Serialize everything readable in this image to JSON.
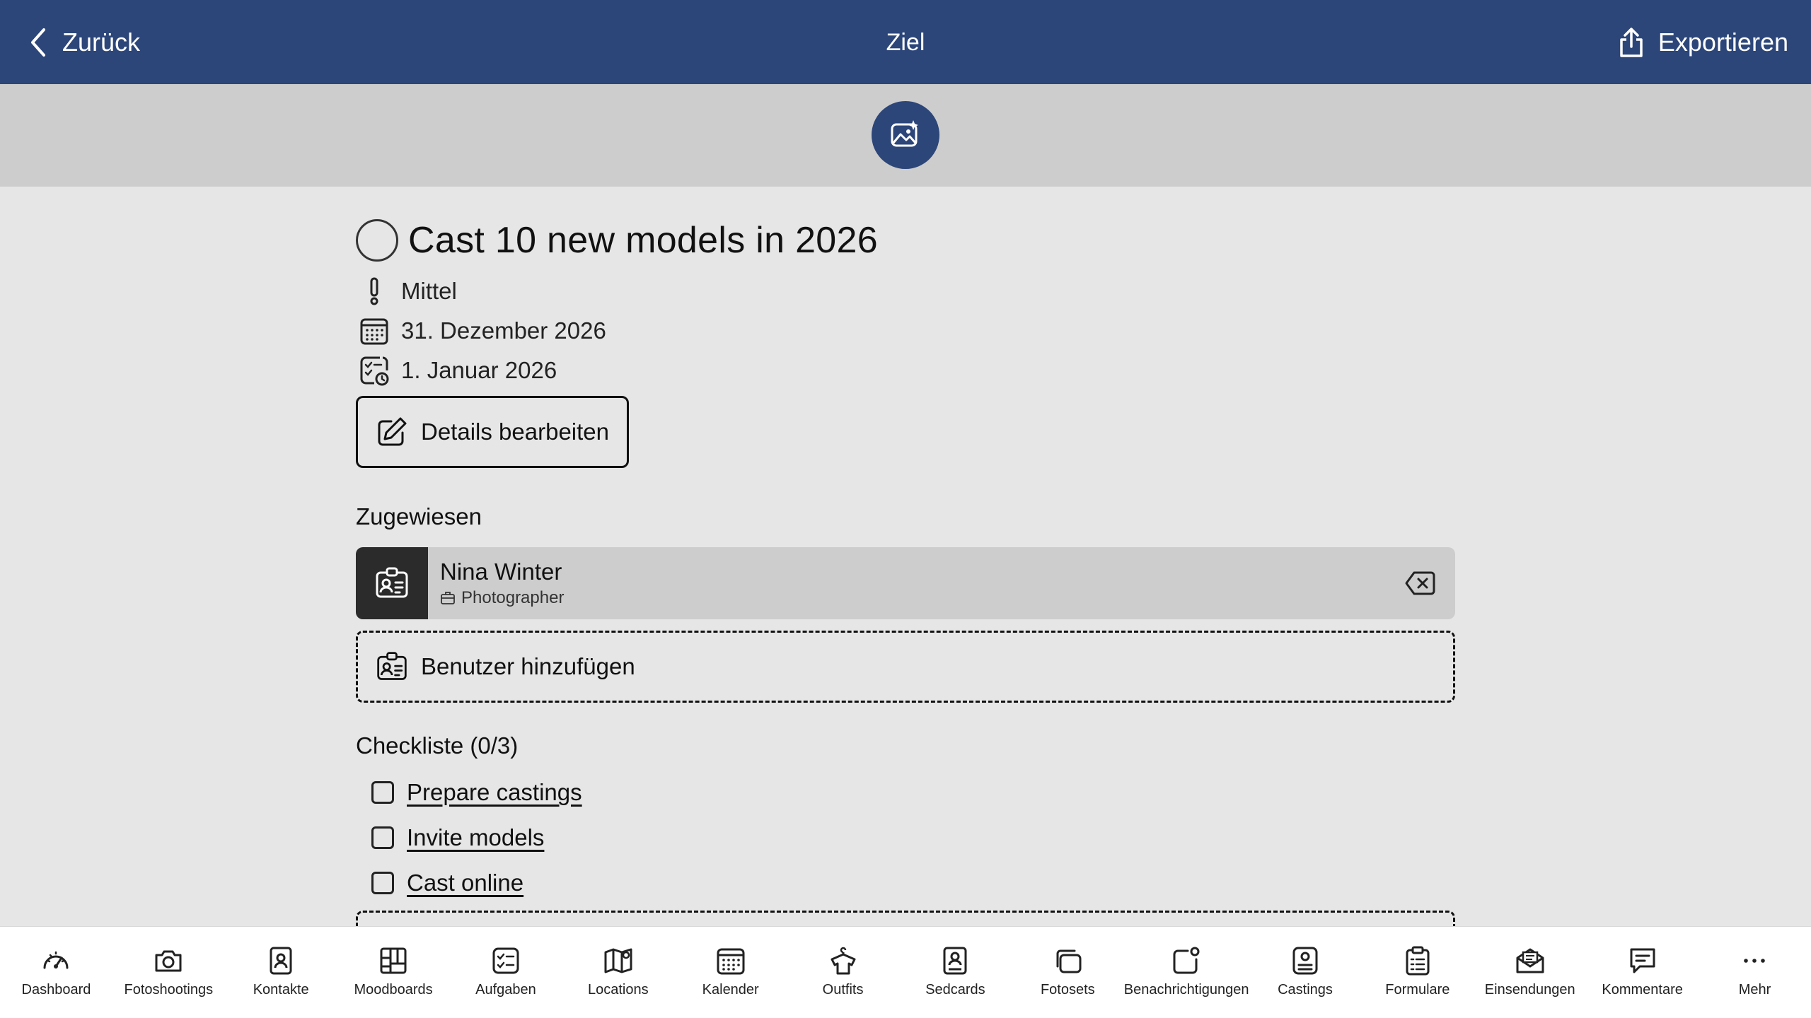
{
  "header": {
    "back_label": "Zurück",
    "title": "Ziel",
    "export_label": "Exportieren",
    "color": "#2c4679"
  },
  "goal": {
    "title": "Cast 10 new models in 2026",
    "priority": "Mittel",
    "due_date": "31. Dezember 2026",
    "start_date": "1. Januar 2026",
    "edit_label": "Details bearbeiten"
  },
  "assigned": {
    "label": "Zugewiesen",
    "users": [
      {
        "name": "Nina Winter",
        "role": "Photographer"
      }
    ],
    "add_label": "Benutzer hinzufügen"
  },
  "checklist": {
    "label": "Checkliste (0/3)",
    "items": [
      {
        "label": "Prepare castings",
        "checked": false
      },
      {
        "label": "Invite models",
        "checked": false
      },
      {
        "label": "Cast online",
        "checked": false
      }
    ]
  },
  "tabs": [
    {
      "label": "Dashboard",
      "icon": "dashboard-icon"
    },
    {
      "label": "Fotoshootings",
      "icon": "camera-icon"
    },
    {
      "label": "Kontakte",
      "icon": "contact-icon"
    },
    {
      "label": "Moodboards",
      "icon": "moodboard-icon"
    },
    {
      "label": "Aufgaben",
      "icon": "tasks-icon"
    },
    {
      "label": "Locations",
      "icon": "map-icon"
    },
    {
      "label": "Kalender",
      "icon": "calendar-icon"
    },
    {
      "label": "Outfits",
      "icon": "outfit-icon"
    },
    {
      "label": "Sedcards",
      "icon": "sedcard-icon"
    },
    {
      "label": "Fotosets",
      "icon": "photoset-icon"
    },
    {
      "label": "Benachrichtigungen",
      "icon": "notification-icon"
    },
    {
      "label": "Castings",
      "icon": "casting-icon"
    },
    {
      "label": "Formulare",
      "icon": "form-icon"
    },
    {
      "label": "Einsendungen",
      "icon": "submission-icon"
    },
    {
      "label": "Kommentare",
      "icon": "comment-icon"
    },
    {
      "label": "Mehr",
      "icon": "more-icon"
    }
  ]
}
